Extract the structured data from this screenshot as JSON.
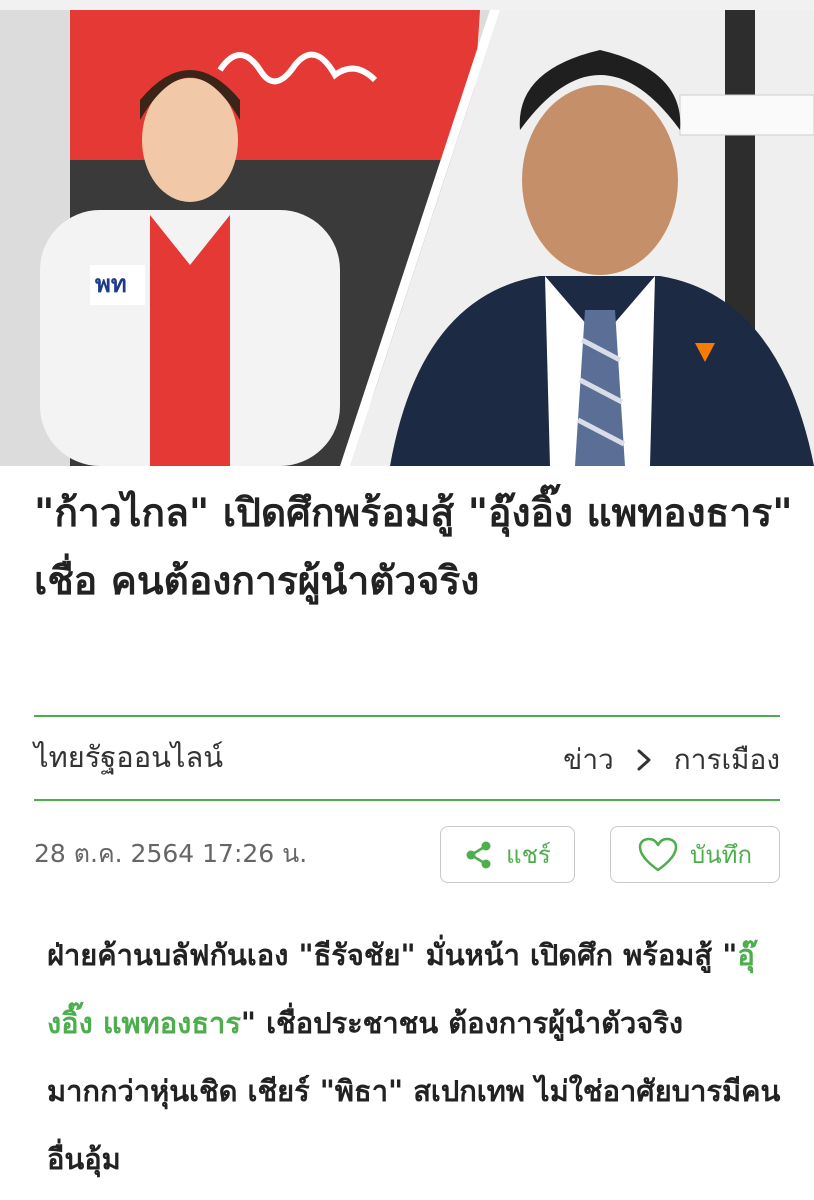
{
  "hero": {
    "left_photo_desc": "woman-in-white-jacket",
    "right_photo_desc": "man-in-suit"
  },
  "headline": "\"ก้าวไกล\" เปิดศึกพร้อมสู้ \"อุ๊งอิ๊ง แพทองธาร\" เชื่อ คนต้องการผู้นำตัวจริง",
  "meta": {
    "source": "ไทยรัฐออนไลน์",
    "breadcrumb": [
      "ข่าว",
      "การเมือง"
    ],
    "datetime": "28 ต.ค. 2564 17:26 น."
  },
  "actions": {
    "share_label": "แชร์",
    "save_label": "บันทึก"
  },
  "lede": {
    "part1": "ฝ่ายค้านบลัฟกันเอง \"ธีรัจชัย\" มั่นหน้า เปิดศึก พร้อมสู้ \"",
    "highlight": "อุ๊งอิ๊ง แพทองธาร",
    "part2": "\" เชื่อประชาชน ต้องการผู้นำตัวจริง มากกว่าหุ่นเชิด เชียร์ \"พิธา\" สเปกเทพ ไม่ใช่อาศัยบารมีคนอื่นอุ้ม"
  },
  "colors": {
    "accent": "#4cae4c",
    "text": "#222222",
    "muted": "#666666"
  }
}
